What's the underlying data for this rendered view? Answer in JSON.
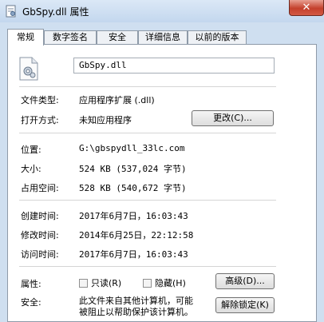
{
  "window": {
    "title": "GbSpy.dll 属性",
    "close_glyph": "✕"
  },
  "tabs": [
    "常规",
    "数字签名",
    "安全",
    "详细信息",
    "以前的版本"
  ],
  "file": {
    "name": "GbSpy.dll",
    "type_label": "文件类型:",
    "type_value": "应用程序扩展 (.dll)",
    "open_label": "打开方式:",
    "open_value": "未知应用程序",
    "change_button": "更改(C)...",
    "location_label": "位置:",
    "location_value": "G:\\gbspydll_33lc.com",
    "size_label": "大小:",
    "size_value": "524 KB (537,024 字节)",
    "disk_label": "占用空间:",
    "disk_value": "528 KB (540,672 字节)",
    "created_label": "创建时间:",
    "created_value": "2017年6月7日，16:03:43",
    "modified_label": "修改时间:",
    "modified_value": "2014年6月25日，22:12:58",
    "accessed_label": "访问时间:",
    "accessed_value": "2017年6月7日，16:03:43",
    "attr_label": "属性:",
    "readonly_label": "只读(R)",
    "hidden_label": "隐藏(H)",
    "advanced_button": "高级(D)...",
    "security_label": "安全:",
    "security_line1": "此文件来自其他计算机，可能",
    "security_line2": "被阻止以帮助保护该计算机。",
    "unblock_button": "解除锁定(K)"
  }
}
